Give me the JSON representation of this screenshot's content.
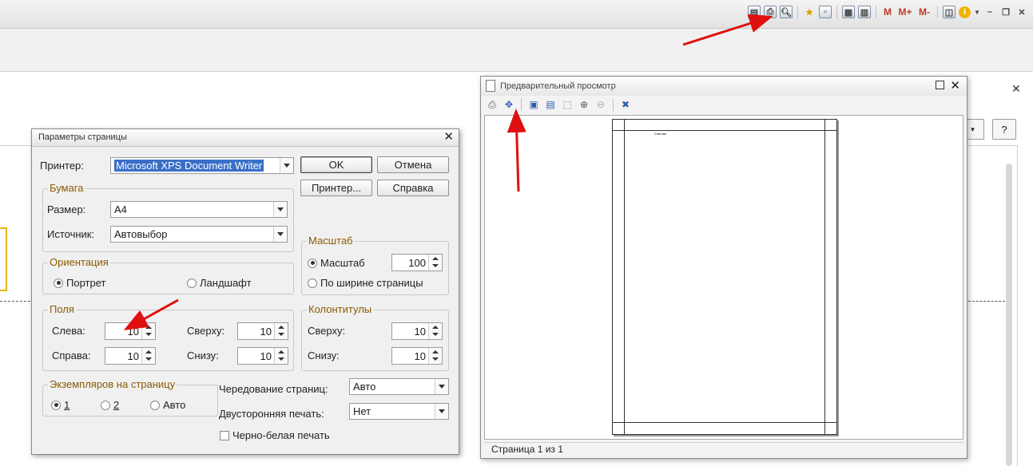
{
  "app": {
    "toolbar_icons": [
      "save-icon",
      "print-icon",
      "print-preview-icon",
      "add-favorite-icon",
      "clipboard-icon",
      "calculator-icon",
      "calendar-icon",
      "M",
      "M+",
      "M-",
      "panel-toggle-icon",
      "info-icon",
      "minimize-icon",
      "restore-icon",
      "close-icon"
    ],
    "memory_labels": {
      "m": "M",
      "m_plus": "M+",
      "m_minus": "M-"
    },
    "help_button": "?"
  },
  "page_setup_dialog": {
    "title": "Параметры страницы",
    "printer_label": "Принтер:",
    "printer_value": "Microsoft XPS Document Writer",
    "ok_button": "OK",
    "cancel_button": "Отмена",
    "printer_button": "Принтер...",
    "help_button": "Справка",
    "paper_group": "Бумага",
    "size_label": "Размер:",
    "size_value": "А4",
    "source_label": "Источник:",
    "source_value": "Автовыбор",
    "scale_group": "Масштаб",
    "scale_radio": "Масштаб",
    "scale_value": "100",
    "fit_width_radio": "По ширине страницы",
    "orientation_group": "Ориентация",
    "portrait": "Портрет",
    "landscape": "Ландшафт",
    "margins_group": "Поля",
    "left_label": "Слева:",
    "left_value": "10",
    "right_label": "Справа:",
    "right_value": "10",
    "top_label": "Сверху:",
    "top_value": "10",
    "bottom_label": "Снизу:",
    "bottom_value": "10",
    "headers_group": "Колонтитулы",
    "header_top_label": "Сверху:",
    "header_top_value": "10",
    "header_bottom_label": "Снизу:",
    "header_bottom_value": "10",
    "copies_group": "Экземпляров на страницу",
    "copies_1": "1",
    "copies_2": "2",
    "copies_auto": "Авто",
    "page_order_label": "Чередование страниц:",
    "page_order_value": "Авто",
    "duplex_label": "Двусторонняя печать:",
    "duplex_value": "Нет",
    "bw_label": "Черно-белая печать"
  },
  "preview_window": {
    "title": "Предварительный просмотр",
    "tools": [
      "print-icon",
      "fit-page-icon",
      "page-setup-icon",
      "page-setup-alt-icon",
      "margins-icon",
      "zoom-in-icon",
      "zoom-out-icon",
      "close-preview-icon"
    ],
    "page_text": "Счетчик",
    "status": "Страница 1 из 1"
  }
}
